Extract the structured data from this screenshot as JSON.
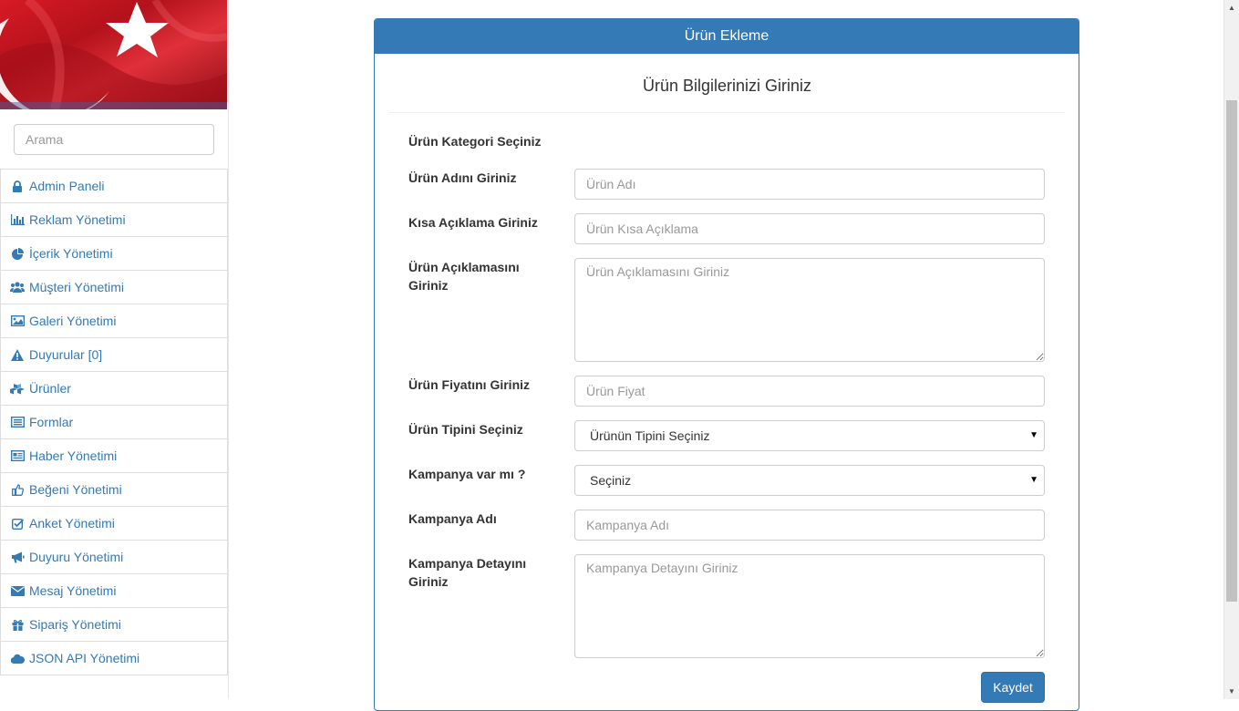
{
  "sidebar": {
    "search_placeholder": "Arama",
    "items": [
      {
        "label": "Admin Paneli",
        "icon": "lock-icon"
      },
      {
        "label": "Reklam Yönetimi",
        "icon": "bar-chart-icon"
      },
      {
        "label": "İçerik Yönetimi",
        "icon": "pie-chart-icon"
      },
      {
        "label": "Müşteri Yönetimi",
        "icon": "users-icon"
      },
      {
        "label": "Galeri Yönetimi",
        "icon": "image-icon"
      },
      {
        "label": "Duyurular [0]",
        "icon": "warning-icon"
      },
      {
        "label": "Ürünler",
        "icon": "cubes-icon"
      },
      {
        "label": "Formlar",
        "icon": "list-icon"
      },
      {
        "label": "Haber Yönetimi",
        "icon": "newspaper-icon"
      },
      {
        "label": "Beğeni Yönetimi",
        "icon": "thumbs-up-icon"
      },
      {
        "label": "Anket Yönetimi",
        "icon": "check-square-icon"
      },
      {
        "label": "Duyuru Yönetimi",
        "icon": "bullhorn-icon"
      },
      {
        "label": "Mesaj Yönetimi",
        "icon": "envelope-icon"
      },
      {
        "label": "Sipariş Yönetimi",
        "icon": "gift-icon"
      },
      {
        "label": "JSON API Yönetimi",
        "icon": "cloud-icon"
      }
    ]
  },
  "panel": {
    "heading": "Ürün Ekleme",
    "subtitle": "Ürün Bilgilerinizi Giriniz",
    "category_label": "Ürün Kategori Seçiniz",
    "name_label": "Ürün Adını Giriniz",
    "name_placeholder": "Ürün Adı",
    "short_desc_label": "Kısa Açıklama Giriniz",
    "short_desc_placeholder": "Ürün Kısa Açıklama",
    "desc_label_line1": "Ürün Açıklamasını",
    "desc_label_line2": "Giriniz",
    "desc_placeholder": "Ürün Açıklamasını Giriniz",
    "price_label": "Ürün Fiyatını Giriniz",
    "price_placeholder": "Ürün Fiyat",
    "type_label": "Ürün Tipini Seçiniz",
    "type_selected": "Ürünün Tipini Seçiniz",
    "campaign_label": "Kampanya var mı ?",
    "campaign_selected": "Seçiniz",
    "campaign_name_label": "Kampanya Adı",
    "campaign_name_placeholder": "Kampanya Adı",
    "campaign_detail_label_line1": "Kampanya Detayını",
    "campaign_detail_label_line2": "Giriniz",
    "campaign_detail_placeholder": "Kampanya Detayını Giriniz",
    "save_label": "Kaydet"
  },
  "colors": {
    "primary": "#337ab7",
    "flag_red": "#e30a17"
  }
}
